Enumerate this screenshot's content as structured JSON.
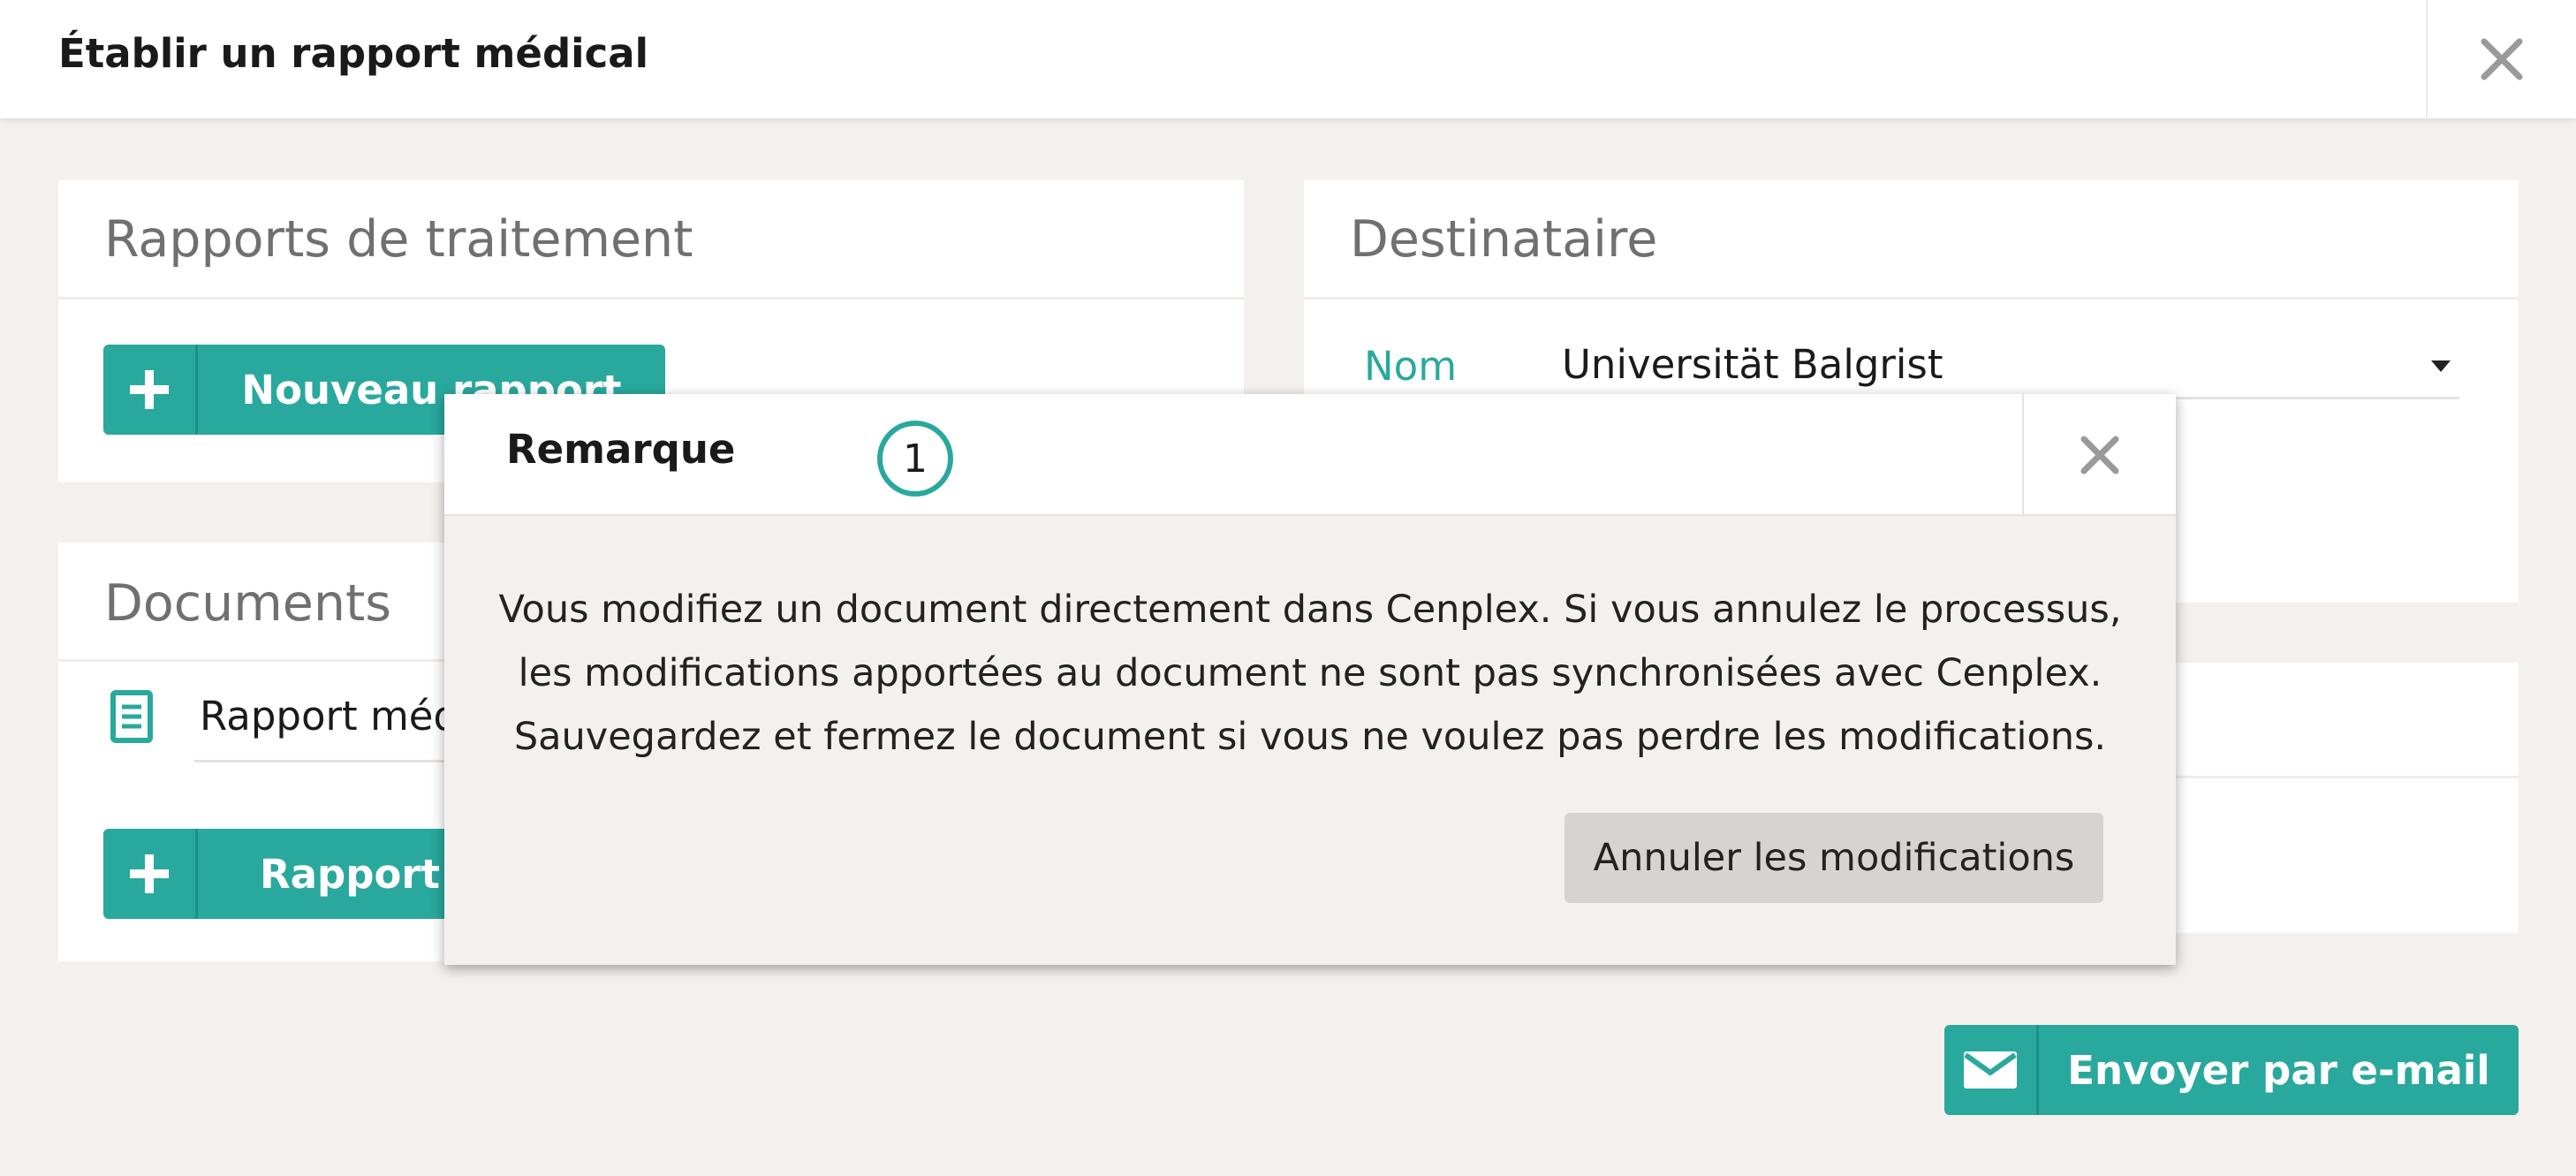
{
  "header": {
    "title": "Établir un rapport médical"
  },
  "treatment_reports": {
    "title": "Rapports de traitement",
    "new_report_label": "Nouveau rapport"
  },
  "recipient": {
    "title": "Destinataire",
    "name_label": "Nom",
    "name_value": "Universität Balgrist"
  },
  "documents": {
    "title": "Documents",
    "items": [
      {
        "label": "Rapport méd"
      }
    ],
    "add_label": "Rapport d"
  },
  "send_email": {
    "label": "Envoyer par e-mail"
  },
  "modal": {
    "title": "Remarque",
    "step": "1",
    "message_lines": [
      "Vous modifiez un document directement dans Cenplex. Si vous annulez le processus,",
      "les modifications apportées au document ne sont pas synchronisées avec Cenplex.",
      "Sauvegardez et fermez le document si vous ne voulez pas perdre les modifications."
    ],
    "cancel_label": "Annuler les modifications"
  },
  "colors": {
    "accent": "#29a89d",
    "background": "#f4f0ed"
  },
  "icons": {
    "close": "close-icon",
    "plus": "plus-icon",
    "document": "document-icon",
    "mail": "mail-icon",
    "dropdown": "dropdown-caret-icon"
  }
}
